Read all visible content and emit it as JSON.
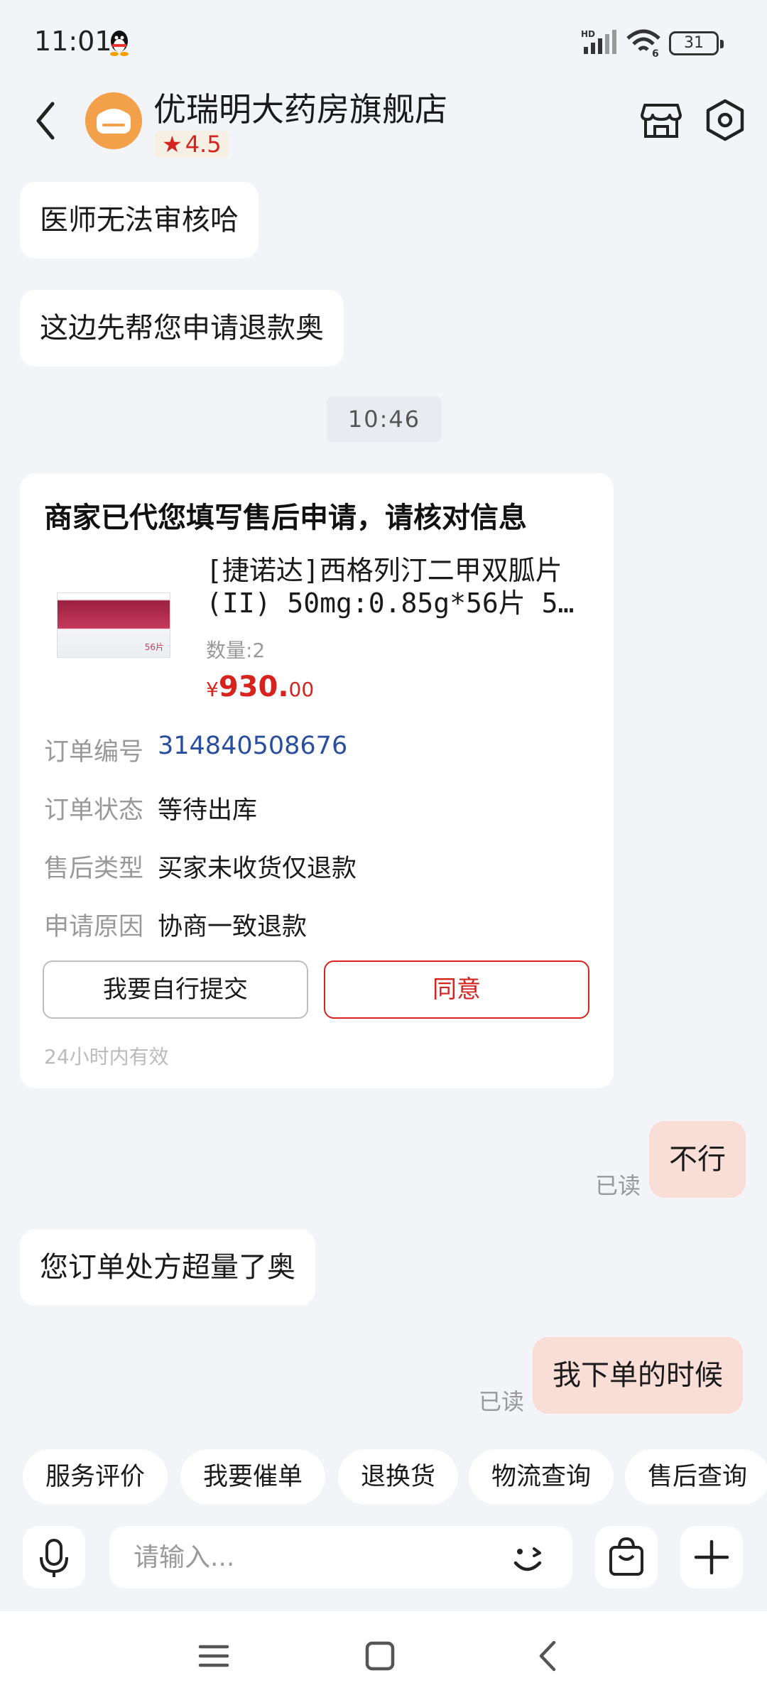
{
  "status_bar": {
    "time": "11:01",
    "battery": "31"
  },
  "header": {
    "shop_name": "优瑞明大药房旗舰店",
    "rating": "4.5"
  },
  "messages": {
    "m1": "医师无法审核哈",
    "m2": "这边先帮您申请退款奥",
    "timestamp": "10:46",
    "m3": "不行",
    "m3_read": "已读",
    "m4": "您订单处方超量了奥",
    "m5": "我下单的时候",
    "m5_read": "已读"
  },
  "card": {
    "title": "商家已代您填写售后申请，请核对信息",
    "product_name_line1": "[捷诺达]西格列汀二甲双胍片",
    "product_name_line2": "(II) 50mg:0.85g*56片 5…",
    "product_image_label": "西格列汀二甲双胍片(II)",
    "quantity": "数量:2",
    "price_currency": "¥",
    "price_int": "930.",
    "price_dec": "00",
    "rows": [
      {
        "label": "订单编号",
        "value": "314840508676"
      },
      {
        "label": "订单状态",
        "value": "等待出库"
      },
      {
        "label": "售后类型",
        "value": "买家未收货仅退款"
      },
      {
        "label": "申请原因",
        "value": "协商一致退款"
      }
    ],
    "self_submit_label": "我要自行提交",
    "agree_label": "同意",
    "validity": "24小时内有效"
  },
  "quick_actions": [
    "服务评价",
    "我要催单",
    "退换货",
    "物流查询",
    "售后查询"
  ],
  "input": {
    "placeholder": "请输入..."
  },
  "icons": {
    "back": "back-arrow-icon",
    "store": "store-icon",
    "settings": "hexagon-settings-icon",
    "mic": "microphone-icon",
    "emoji": "wink-emoji-icon",
    "bag": "shopping-bag-icon",
    "plus": "plus-icon"
  },
  "colors": {
    "accent_red": "#D6231E",
    "outgoing_bubble": "#F9DDD7",
    "background": "#F2F4F8",
    "order_link": "#2A4E9E"
  }
}
